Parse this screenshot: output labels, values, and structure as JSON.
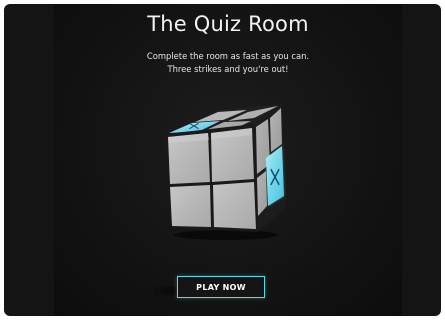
{
  "screen": {
    "title": "The Quiz Room",
    "subtitle_line1": "Complete the room as fast as you can.",
    "subtitle_line2": "Three strikes and you're out!",
    "play_button": "PLAY NOW"
  },
  "cube": {
    "face_color": "#b9b9b9",
    "highlight_color": "#4fc6e4",
    "icon": "cross-swords-icon"
  },
  "colors": {
    "background": "#141414",
    "accent": "#5fd8e6"
  }
}
